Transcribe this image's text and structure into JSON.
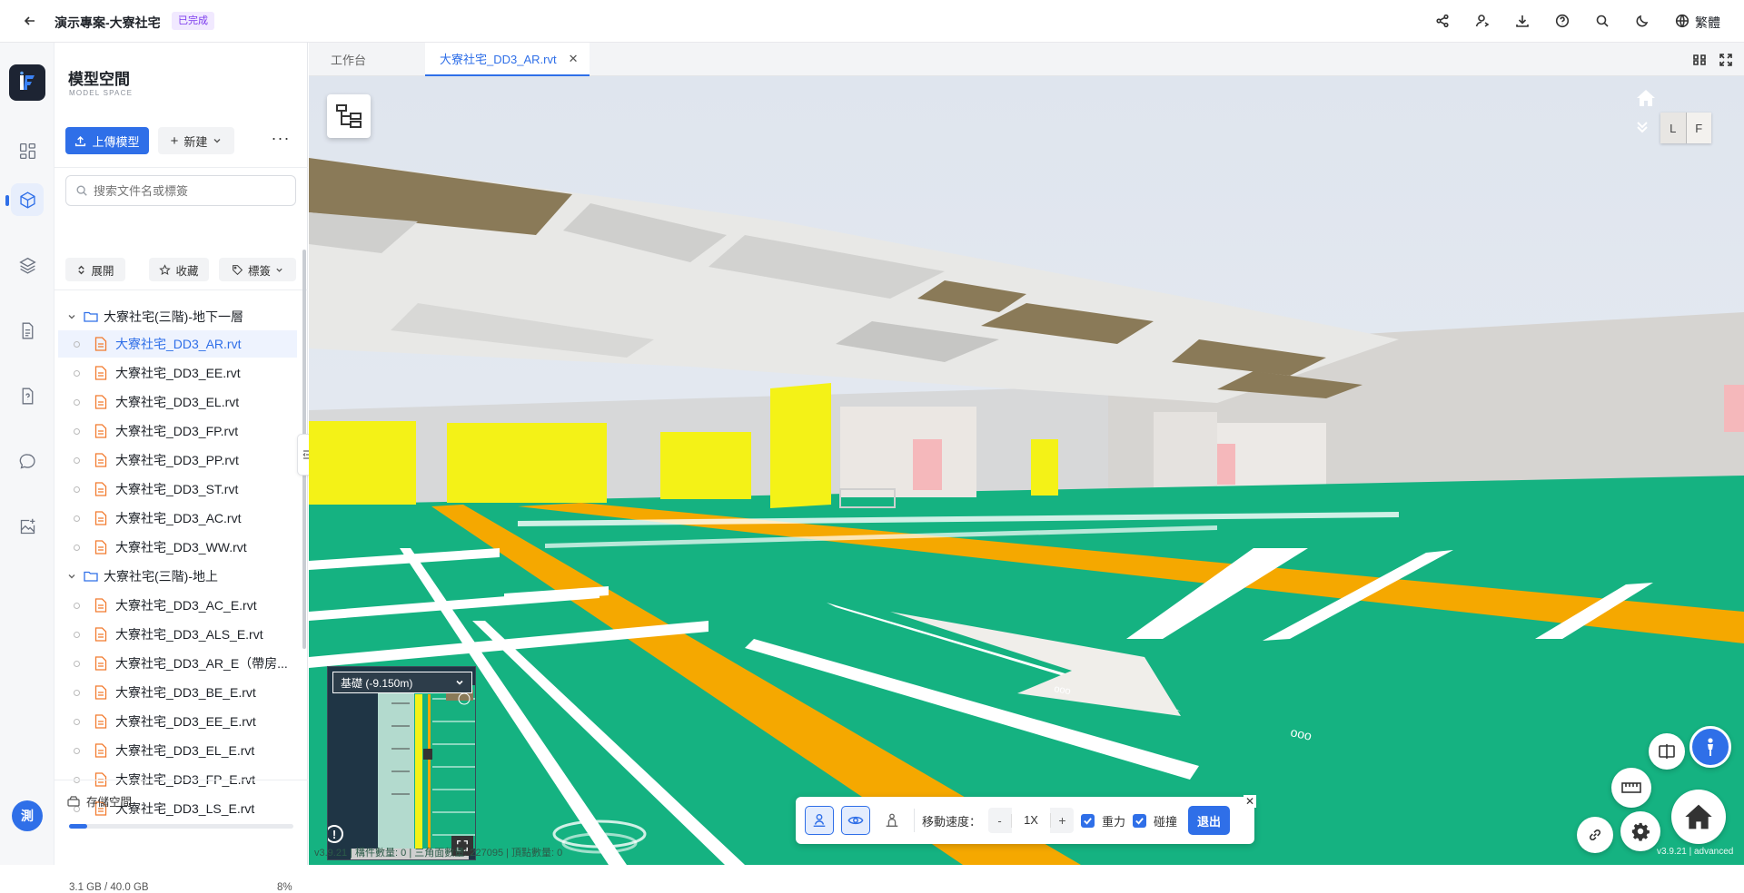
{
  "header": {
    "project_title": "演示專案-大寮社宅",
    "status_badge": "已完成",
    "language_label": "繁體"
  },
  "brand": {
    "title": "模型空間",
    "subtitle": "MODEL SPACE"
  },
  "toolbar": {
    "upload_label": "上傳模型",
    "new_label": "新建",
    "search_placeholder": "搜索文件名或標簽",
    "expand_label": "展開",
    "favorite_label": "收藏",
    "tag_label": "標簽"
  },
  "tree": {
    "folders": [
      {
        "name": "大寮社宅(三階)-地下一層",
        "files": [
          "大寮社宅_DD3_AR.rvt",
          "大寮社宅_DD3_EE.rvt",
          "大寮社宅_DD3_EL.rvt",
          "大寮社宅_DD3_FP.rvt",
          "大寮社宅_DD3_PP.rvt",
          "大寮社宅_DD3_ST.rvt",
          "大寮社宅_DD3_AC.rvt",
          "大寮社宅_DD3_WW.rvt"
        ]
      },
      {
        "name": "大寮社宅(三階)-地上",
        "files": [
          "大寮社宅_DD3_AC_E.rvt",
          "大寮社宅_DD3_ALS_E.rvt",
          "大寮社宅_DD3_AR_E（帶房...",
          "大寮社宅_DD3_BE_E.rvt",
          "大寮社宅_DD3_EE_E.rvt",
          "大寮社宅_DD3_EL_E.rvt",
          "大寮社宅_DD3_FP_E.rvt",
          "大寮社宅_DD3_LS_E.rvt"
        ]
      }
    ]
  },
  "storage": {
    "label": "存儲空間",
    "used": "3.1 GB / 40.0 GB",
    "percent_text": "8%",
    "percent": 8
  },
  "user": {
    "avatar_text": "測"
  },
  "tabs": [
    {
      "label": "工作台"
    },
    {
      "label": "大寮社宅_DD3_AR.rvt"
    }
  ],
  "minimap": {
    "level": "基礎 (-9.150m)"
  },
  "walk": {
    "speed_label": "移動速度：",
    "speed_minus": "-",
    "speed_value": "1X",
    "speed_plus": "+",
    "gravity_label": "重力",
    "collision_label": "碰撞",
    "exit_label": "退出"
  },
  "viewcube": {
    "left": "L",
    "front": "F"
  },
  "footer": {
    "stats": "v3.9.21 | 構件數量: 0 | 三角面數量: 227095 | 頂點數量: 0",
    "version": "v3.9.21 | advanced"
  },
  "colors": {
    "accent": "#2f6fe8",
    "floor": "#13b07f",
    "lane": "#f5a800",
    "wall_yellow": "#f4f217"
  }
}
